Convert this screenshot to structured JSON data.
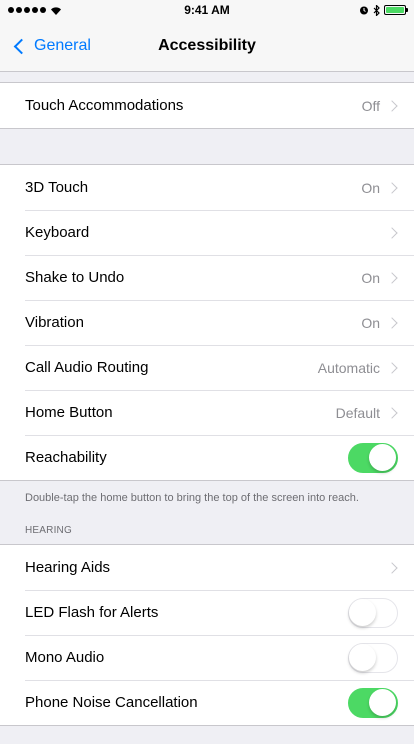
{
  "status_bar": {
    "time": "9:41 AM",
    "battery_color": "#4cd964"
  },
  "nav": {
    "back_label": "General",
    "title": "Accessibility"
  },
  "group_touch": {
    "items": [
      {
        "label": "Touch Accommodations",
        "value": "Off"
      }
    ]
  },
  "group_main": {
    "items": [
      {
        "label": "3D Touch",
        "value": "On"
      },
      {
        "label": "Keyboard",
        "value": ""
      },
      {
        "label": "Shake to Undo",
        "value": "On"
      },
      {
        "label": "Vibration",
        "value": "On"
      },
      {
        "label": "Call Audio Routing",
        "value": "Automatic"
      },
      {
        "label": "Home Button",
        "value": "Default"
      },
      {
        "label": "Reachability",
        "toggle": true
      }
    ],
    "footer": "Double-tap the home button to bring the top of the screen into reach."
  },
  "hearing": {
    "header": "HEARING",
    "items": [
      {
        "label": "Hearing Aids",
        "value": ""
      },
      {
        "label": "LED Flash for Alerts",
        "toggle": false
      },
      {
        "label": "Mono Audio",
        "toggle": false
      },
      {
        "label": "Phone Noise Cancellation",
        "toggle": true
      }
    ]
  },
  "colors": {
    "accent": "#007aff",
    "toggle_on": "#4cd964",
    "background": "#efeff4"
  }
}
